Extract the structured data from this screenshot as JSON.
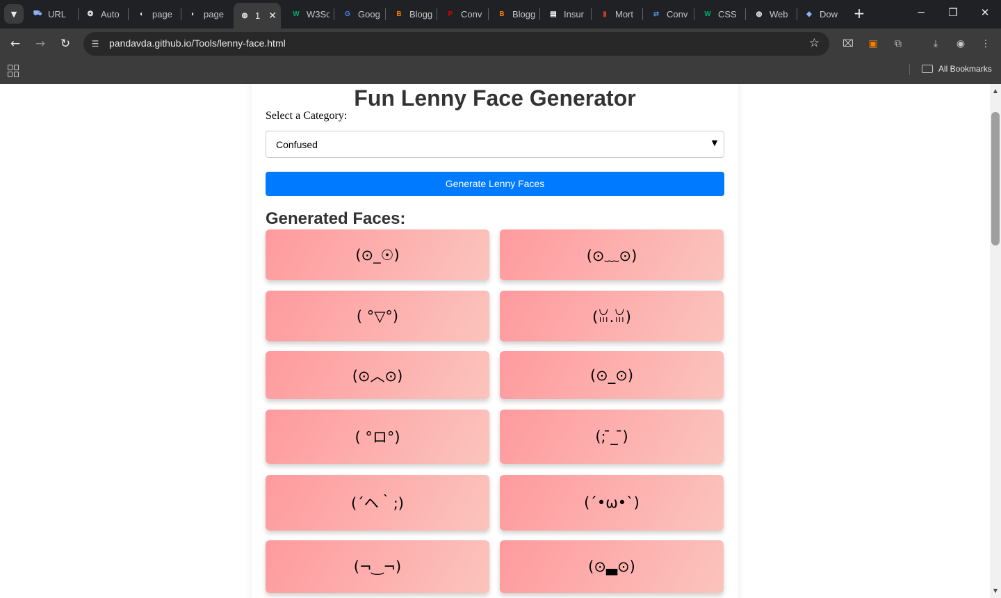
{
  "browser": {
    "tabs": [
      {
        "label": "URL",
        "icon": "car-icon",
        "color": "#8ab4f8"
      },
      {
        "label": "Auto",
        "icon": "openai-icon",
        "color": "#e8eaed"
      },
      {
        "label": "page",
        "icon": "github-icon",
        "color": "#e8eaed"
      },
      {
        "label": "page",
        "icon": "github-icon",
        "color": "#e8eaed"
      },
      {
        "label": "1",
        "icon": "globe-icon",
        "color": "#e8eaed",
        "active": true
      },
      {
        "label": "W3Sc",
        "icon": "w3-icon",
        "color": "#04aa6d"
      },
      {
        "label": "Goog",
        "icon": "translate-icon",
        "color": "#4285f4"
      },
      {
        "label": "Blogg",
        "icon": "blogger-icon",
        "color": "#f57d00"
      },
      {
        "label": "Conv",
        "icon": "pdf-icon",
        "color": "#d50000"
      },
      {
        "label": "Blogg",
        "icon": "blogger-icon",
        "color": "#f57d00"
      },
      {
        "label": "Insur",
        "icon": "doc-icon",
        "color": "#ffffff"
      },
      {
        "label": "Mort",
        "icon": "book-icon",
        "color": "#c0392b"
      },
      {
        "label": "Conv",
        "icon": "convert-icon",
        "color": "#4a90e2"
      },
      {
        "label": "CSS",
        "icon": "w3-icon",
        "color": "#04aa6d"
      },
      {
        "label": "Web",
        "icon": "globe-icon",
        "color": "#e8eaed"
      },
      {
        "label": "Dow",
        "icon": "diamond-icon",
        "color": "#8ab4f8"
      }
    ],
    "url": "pandavda.github.io/Tools/lenny-face.html",
    "all_bookmarks": "All Bookmarks"
  },
  "page": {
    "title": "Fun Lenny Face Generator",
    "category_label": "Select a Category:",
    "category_selected": "Confused",
    "generate_button": "Generate Lenny Faces",
    "generated_heading": "Generated Faces:",
    "faces": [
      "(⊙_☉)",
      "(⊙﹏⊙)",
      "( °▽°)",
      "(ꈍ.ꈍ)",
      "(⊙︿⊙)",
      "(⊙_⊙)",
      "( °ロ°)",
      "(;  ̄_ ̄)",
      "(´ヘ｀;)",
      "(´•ω•`)",
      "(¬‿¬)",
      "(⊙▃⊙)"
    ]
  },
  "colors": {
    "primary_button": "#007bff",
    "face_gradient_start": "#ff9a9e",
    "face_gradient_end": "#fbc4bd",
    "title_text": "#333333"
  }
}
